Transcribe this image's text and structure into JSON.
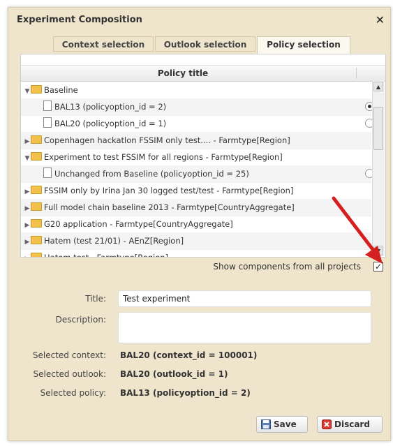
{
  "dialog": {
    "title": "Experiment Composition",
    "close_icon": "close-icon"
  },
  "tabs": [
    {
      "label": "Context selection",
      "active": false
    },
    {
      "label": "Outlook selection",
      "active": false
    },
    {
      "label": "Policy selection",
      "active": true
    }
  ],
  "grid": {
    "header": "Policy title",
    "rows": [
      {
        "label": "Baseline",
        "type": "folder",
        "expanded": true,
        "level": 0
      },
      {
        "label": "BAL13 (policyoption_id = 2)",
        "type": "item",
        "level": 1,
        "radio": "selected"
      },
      {
        "label": "BAL20 (policyoption_id = 1)",
        "type": "item",
        "level": 1,
        "radio": "unselected"
      },
      {
        "label": "Copenhagen hackatlon FSSIM only test.... - Farmtype[Region]",
        "type": "folder",
        "expanded": false,
        "level": 0
      },
      {
        "label": "Experiment to test FSSIM for all regions - Farmtype[Region]",
        "type": "folder",
        "expanded": true,
        "level": 0
      },
      {
        "label": "Unchanged from Baseline (policyoption_id = 25)",
        "type": "item",
        "level": 1,
        "radio": "unselected"
      },
      {
        "label": "FSSIM only by Irina Jan 30 logged test/test - Farmtype[Region]",
        "type": "folder",
        "expanded": false,
        "level": 0
      },
      {
        "label": "Full model chain baseline 2013 - Farmtype[CountryAggregate]",
        "type": "folder",
        "expanded": false,
        "level": 0
      },
      {
        "label": "G20 application - Farmtype[CountryAggregate]",
        "type": "folder",
        "expanded": false,
        "level": 0
      },
      {
        "label": "Hatem (test 21/01) - AEnZ[Region]",
        "type": "folder",
        "expanded": false,
        "level": 0
      },
      {
        "label": "Hatem test - Farmtype[Region]",
        "type": "folder",
        "expanded": false,
        "level": 0
      }
    ]
  },
  "show_all": {
    "label": "Show components from all projects",
    "checked": true,
    "mark": "✓"
  },
  "form": {
    "title_label": "Title:",
    "title_value": "Test experiment",
    "description_label": "Description:",
    "description_value": "",
    "context_label": "Selected context:",
    "context_value": "BAL20 (context_id = 100001)",
    "outlook_label": "Selected outlook:",
    "outlook_value": "BAL20 (outlook_id = 1)",
    "policy_label": "Selected policy:",
    "policy_value": "BAL13 (policyoption_id = 2)"
  },
  "buttons": {
    "save": "Save",
    "discard": "Discard"
  },
  "colors": {
    "annotation_arrow": "#d42020",
    "dialog_bg": "#efe4cc"
  }
}
